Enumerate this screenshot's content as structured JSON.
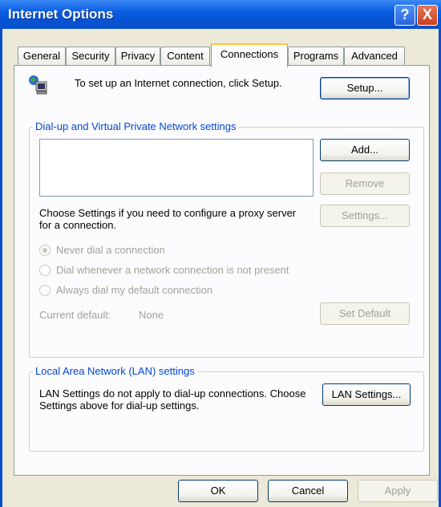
{
  "window": {
    "title": "Internet Options",
    "help_glyph": "?",
    "close_glyph": "X"
  },
  "tabs": [
    {
      "label": "General"
    },
    {
      "label": "Security"
    },
    {
      "label": "Privacy"
    },
    {
      "label": "Content"
    },
    {
      "label": "Connections",
      "active": true
    },
    {
      "label": "Programs"
    },
    {
      "label": "Advanced"
    }
  ],
  "setup": {
    "text": "To set up an Internet connection, click Setup.",
    "button": "Setup..."
  },
  "dialup": {
    "legend": "Dial-up and Virtual Private Network settings",
    "add": "Add...",
    "remove": "Remove",
    "settings": "Settings...",
    "hint": "Choose Settings if you need to configure a proxy server for a connection.",
    "radio_never": "Never dial a connection",
    "radio_whenever": "Dial whenever a network connection is not present",
    "radio_always": "Always dial my default connection",
    "current_default_label": "Current default:",
    "current_default_value": "None",
    "set_default": "Set Default"
  },
  "lan": {
    "legend": "Local Area Network (LAN) settings",
    "text": "LAN Settings do not apply to dial-up connections. Choose Settings above for dial-up settings.",
    "button": "LAN Settings..."
  },
  "footer": {
    "ok": "OK",
    "cancel": "Cancel",
    "apply": "Apply"
  },
  "icons": {
    "setup": "network-computer-icon"
  }
}
